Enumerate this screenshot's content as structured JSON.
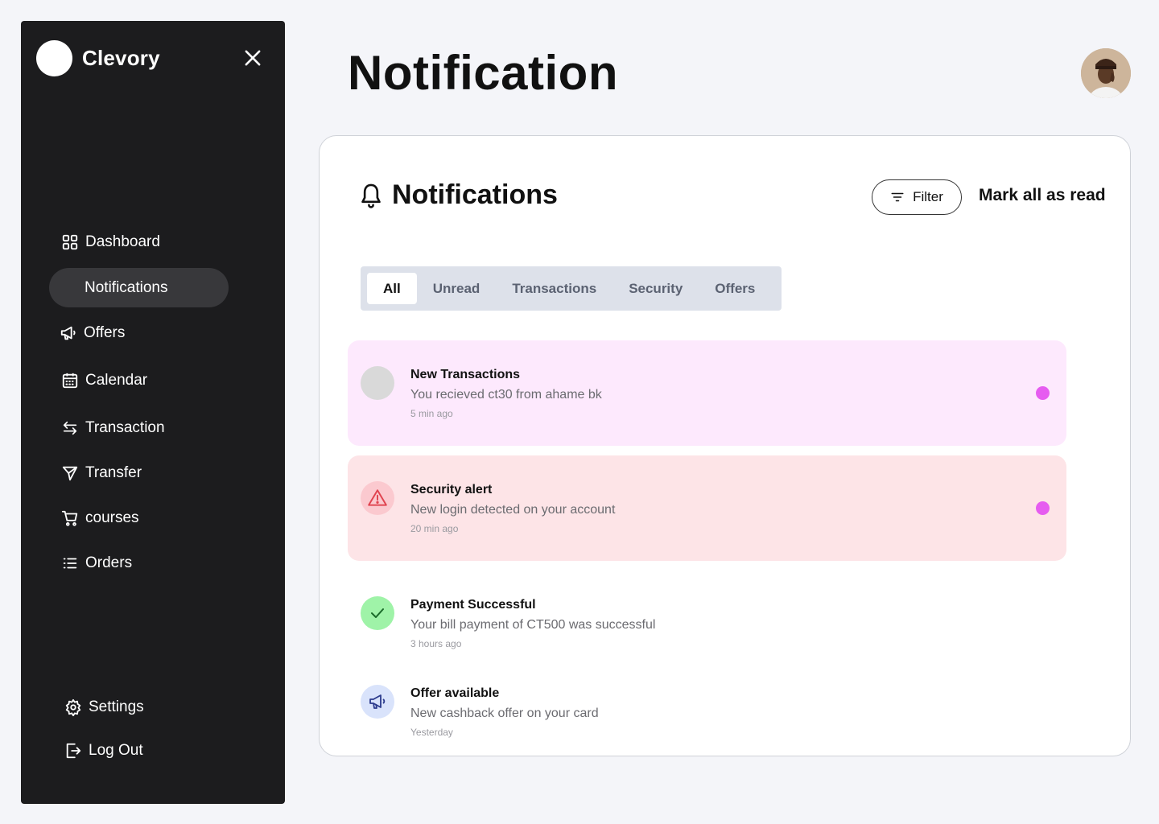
{
  "sidebar": {
    "brand": "Clevory",
    "items": [
      {
        "label": "Dashboard"
      },
      {
        "label": "Notifications"
      },
      {
        "label": "Offers"
      },
      {
        "label": "Calendar"
      },
      {
        "label": "Transaction"
      },
      {
        "label": "Transfer"
      },
      {
        "label": "courses"
      },
      {
        "label": "Orders"
      }
    ],
    "bottom": [
      {
        "label": "Settings"
      },
      {
        "label": "Log Out"
      }
    ]
  },
  "header": {
    "title": "Notification"
  },
  "panel": {
    "title": "Notifications",
    "filter_label": "Filter",
    "mark_all_label": "Mark all as read",
    "tabs": [
      {
        "label": "All"
      },
      {
        "label": "Unread"
      },
      {
        "label": "Transactions"
      },
      {
        "label": "Security"
      },
      {
        "label": "Offers"
      }
    ],
    "notifications": [
      {
        "title": "New Transactions",
        "message": "You recieved ct30 from ahame bk",
        "time": "5 min ago",
        "unread": true,
        "background": "#fde9fd",
        "icon": "placeholder-circle-icon"
      },
      {
        "title": "Security alert",
        "message": "New login detected on your account",
        "time": "20 min ago",
        "unread": true,
        "background": "#fde4e7",
        "icon": "warning-triangle-icon"
      },
      {
        "title": "Payment Successful",
        "message": "Your bill payment of CT500 was successful",
        "time": "3 hours ago",
        "unread": false,
        "background": "#ffffff",
        "icon": "checkmark-icon"
      },
      {
        "title": "Offer available",
        "message": "New cashback offer on your card",
        "time": "Yesterday",
        "unread": false,
        "background": "#ffffff",
        "icon": "megaphone-icon"
      }
    ]
  },
  "colors": {
    "sidebar_bg": "#1c1c1e",
    "unread_dot": "#e65cf0",
    "accent_pink": "#fde9fd",
    "accent_red": "#fde4e7"
  }
}
